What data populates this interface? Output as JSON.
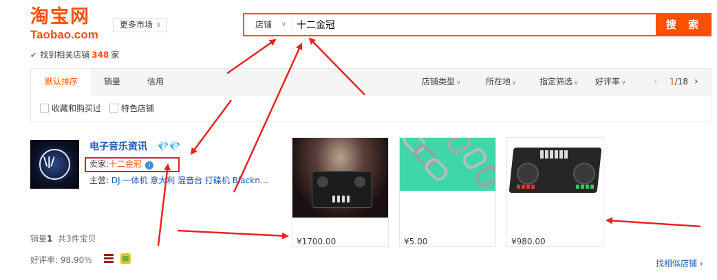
{
  "header": {
    "logo_cn": "淘宝网",
    "logo_en": "Taobao.com",
    "more_market": "更多市场"
  },
  "search": {
    "type_label": "店铺",
    "query": "十二金冠",
    "button": "搜 索"
  },
  "results": {
    "prefix": "找到相关店铺",
    "count": "348",
    "suffix": "家"
  },
  "sort_tabs": [
    "默认排序",
    "销量",
    "信用"
  ],
  "filters": [
    "店铺类型",
    "所在地",
    "指定筛选",
    "好评率"
  ],
  "pager": {
    "current": "1",
    "total": "/18"
  },
  "checkboxes": [
    "收藏和购买过",
    "特色店铺"
  ],
  "shop": {
    "name": "电子音乐资讯",
    "diamonds": "💎💎",
    "seller_label": "卖家:",
    "seller_name": "十二金冠",
    "main_label": "主营:",
    "main_items": "DJ 一体机 意大利 混音台 打碟机 Blacknot...",
    "sales_label": "销量",
    "sales_value": "1",
    "total_items": "共3件宝贝",
    "rating_label": "好评率:",
    "rating_value": "98.90%"
  },
  "products": [
    {
      "price": "¥1700.00"
    },
    {
      "price": "¥5.00"
    },
    {
      "price": "¥980.00"
    }
  ],
  "similar_link": "找相似店铺 ›",
  "colors": {
    "brand": "#ff5000",
    "link": "#1a5bb5",
    "annotation": "#e02020"
  }
}
